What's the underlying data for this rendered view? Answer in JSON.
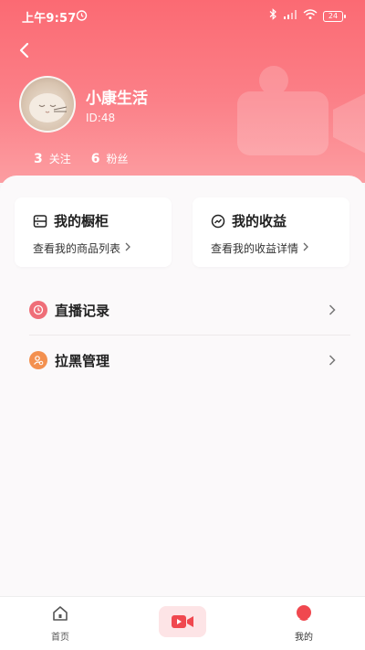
{
  "status_bar": {
    "time": "上午9:57",
    "battery": "24"
  },
  "profile": {
    "name": "小康生活",
    "id": "ID:48",
    "stats": [
      {
        "value": "3",
        "label": "关注"
      },
      {
        "value": "6",
        "label": "粉丝"
      }
    ]
  },
  "cards": [
    {
      "title": "我的橱柜",
      "subtitle": "查看我的商品列表"
    },
    {
      "title": "我的收益",
      "subtitle": "查看我的收益详情"
    }
  ],
  "menu": [
    {
      "label": "直播记录",
      "icon": "clock-icon",
      "color": "#ef6e78"
    },
    {
      "label": "拉黑管理",
      "icon": "user-block-icon",
      "color": "#f3904f"
    }
  ],
  "bottom_nav": {
    "home": "首页",
    "mine": "我的"
  },
  "colors": {
    "accent": "#fb6a73",
    "active_nav": "#f0484f"
  }
}
